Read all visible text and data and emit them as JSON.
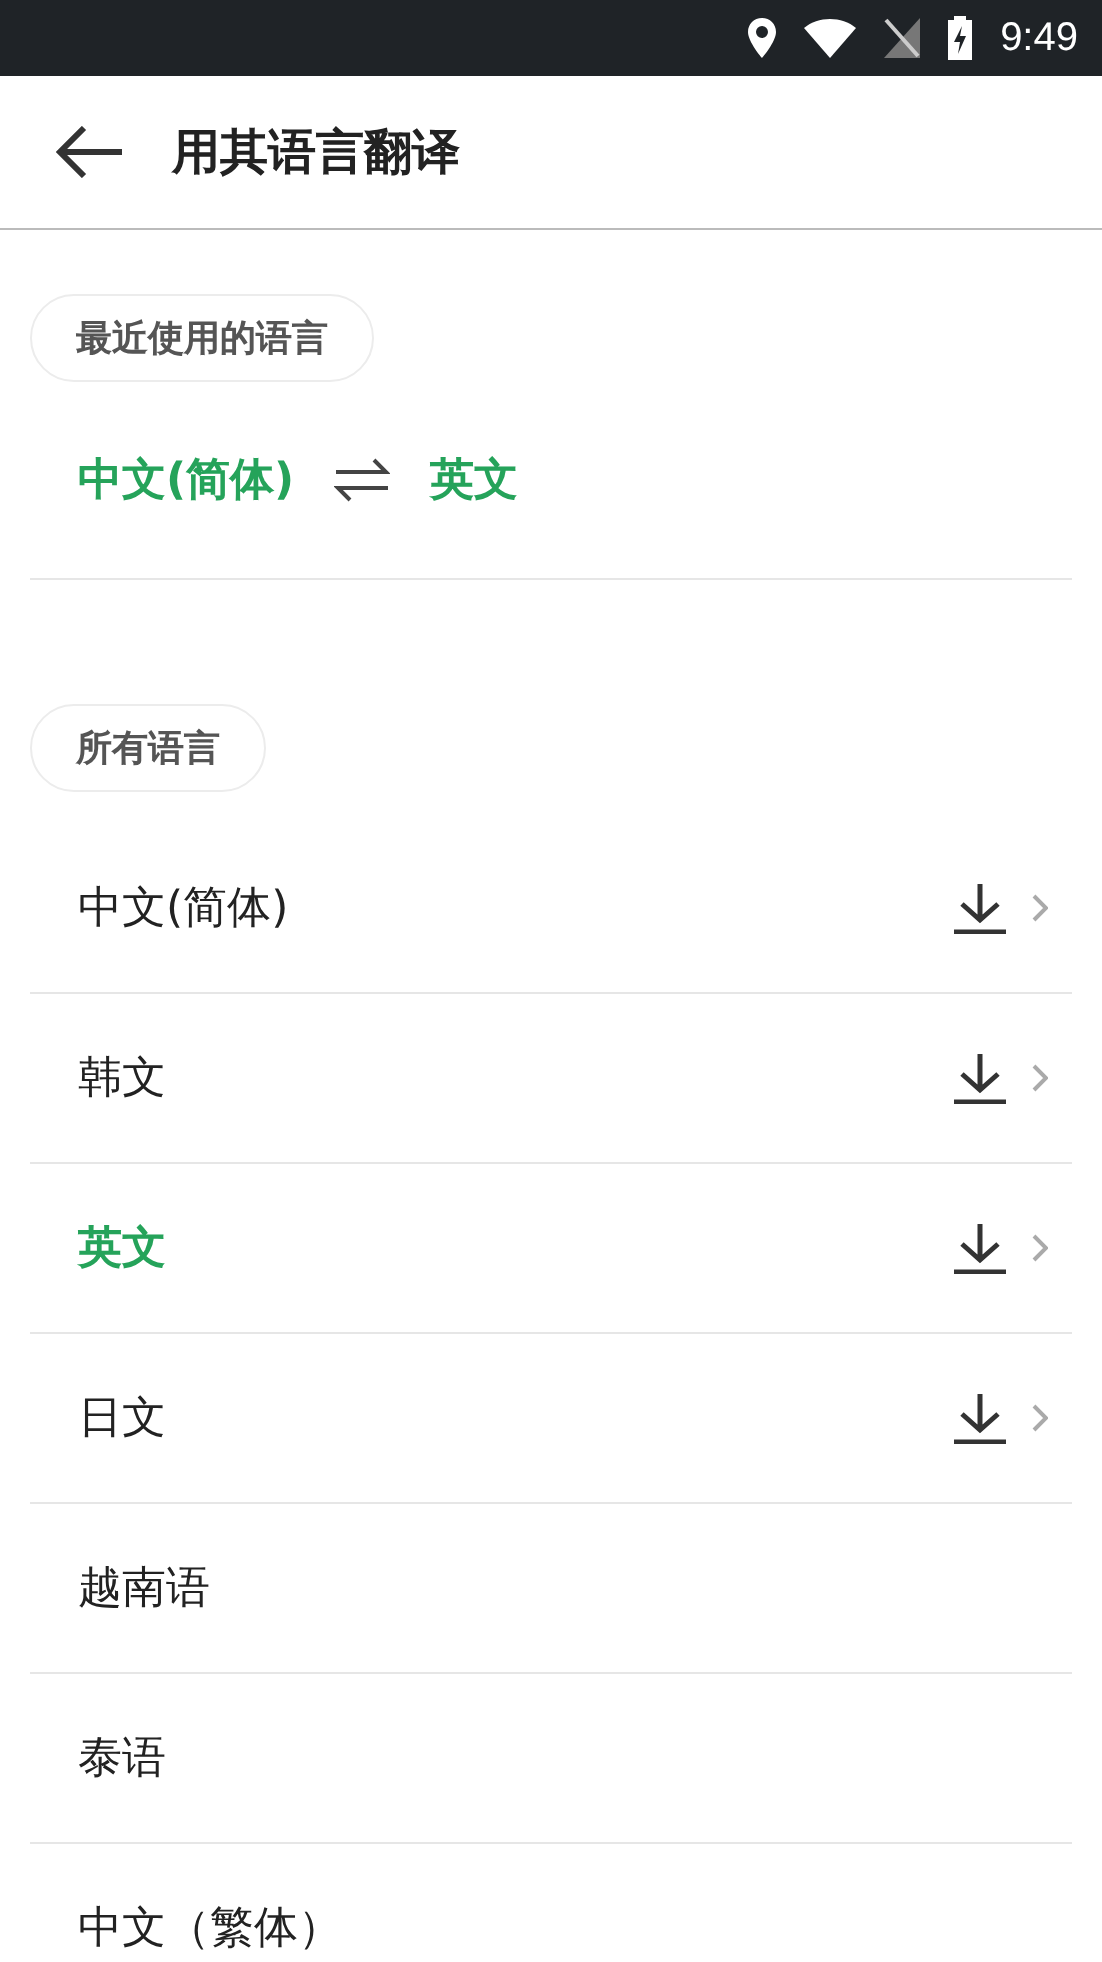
{
  "status_bar": {
    "time": "9:49"
  },
  "header": {
    "title": "用其语言翻译"
  },
  "recent": {
    "label": "最近使用的语言",
    "source": "中文(简体)",
    "target": "英文"
  },
  "all": {
    "label": "所有语言",
    "items": [
      {
        "name": "中文(简体)",
        "selected": false,
        "download": true
      },
      {
        "name": "韩文",
        "selected": false,
        "download": true
      },
      {
        "name": "英文",
        "selected": true,
        "download": true
      },
      {
        "name": "日文",
        "selected": false,
        "download": true
      },
      {
        "name": "越南语",
        "selected": false,
        "download": false
      },
      {
        "name": "泰语",
        "selected": false,
        "download": false
      },
      {
        "name": "中文（繁体）",
        "selected": false,
        "download": false
      }
    ]
  }
}
